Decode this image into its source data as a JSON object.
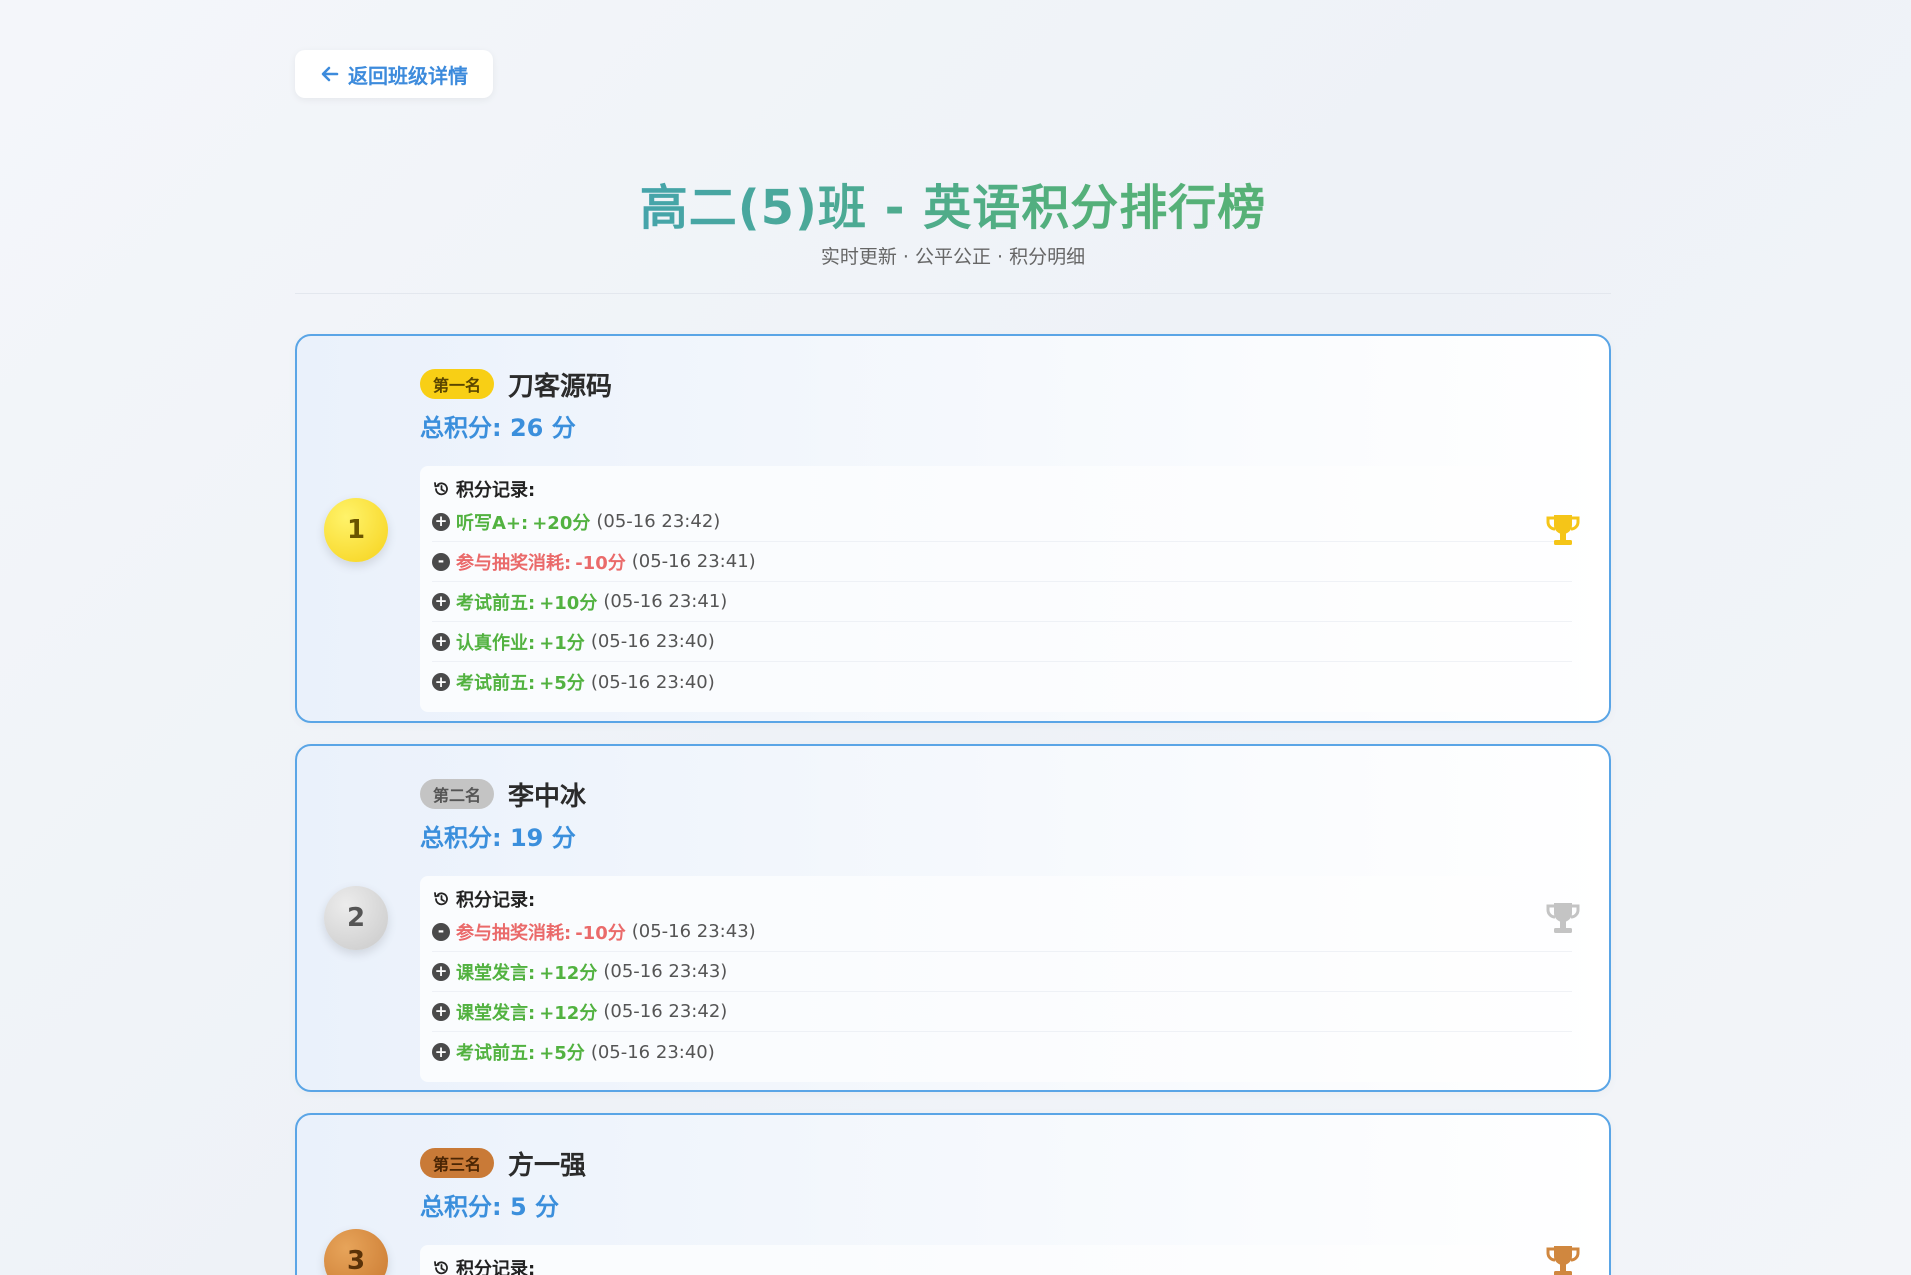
{
  "back_button": {
    "label": "返回班级详情"
  },
  "header": {
    "title": "高二(5)班 - 英语积分排行榜",
    "subtitle": "实时更新 · 公平公正 · 积分明细"
  },
  "records_label": "积分记录:",
  "colors": {
    "accent": "#3d8bdc",
    "positive": "#52b240",
    "negative": "#ea6a6a",
    "gold": "#f8cf15",
    "silver": "#c4c4c4",
    "bronze": "#c97a37"
  },
  "students": [
    {
      "rank": "1",
      "badge": "第一名",
      "name": "刀客源码",
      "total": "总积分: 26 分",
      "records": [
        {
          "sign": "+",
          "reason": "听写A+:",
          "points": "+20分",
          "time": "(05-16 23:42)"
        },
        {
          "sign": "-",
          "reason": "参与抽奖消耗:",
          "points": "-10分",
          "time": "(05-16 23:41)"
        },
        {
          "sign": "+",
          "reason": "考试前五:",
          "points": "+10分",
          "time": "(05-16 23:41)"
        },
        {
          "sign": "+",
          "reason": "认真作业:",
          "points": "+1分",
          "time": "(05-16 23:40)"
        },
        {
          "sign": "+",
          "reason": "考试前五:",
          "points": "+5分",
          "time": "(05-16 23:40)"
        }
      ]
    },
    {
      "rank": "2",
      "badge": "第二名",
      "name": "李中冰",
      "total": "总积分: 19 分",
      "records": [
        {
          "sign": "-",
          "reason": "参与抽奖消耗:",
          "points": "-10分",
          "time": "(05-16 23:43)"
        },
        {
          "sign": "+",
          "reason": "课堂发言:",
          "points": "+12分",
          "time": "(05-16 23:43)"
        },
        {
          "sign": "+",
          "reason": "课堂发言:",
          "points": "+12分",
          "time": "(05-16 23:42)"
        },
        {
          "sign": "+",
          "reason": "考试前五:",
          "points": "+5分",
          "time": "(05-16 23:40)"
        }
      ]
    },
    {
      "rank": "3",
      "badge": "第三名",
      "name": "方一强",
      "total": "总积分: 5 分",
      "records": []
    }
  ]
}
